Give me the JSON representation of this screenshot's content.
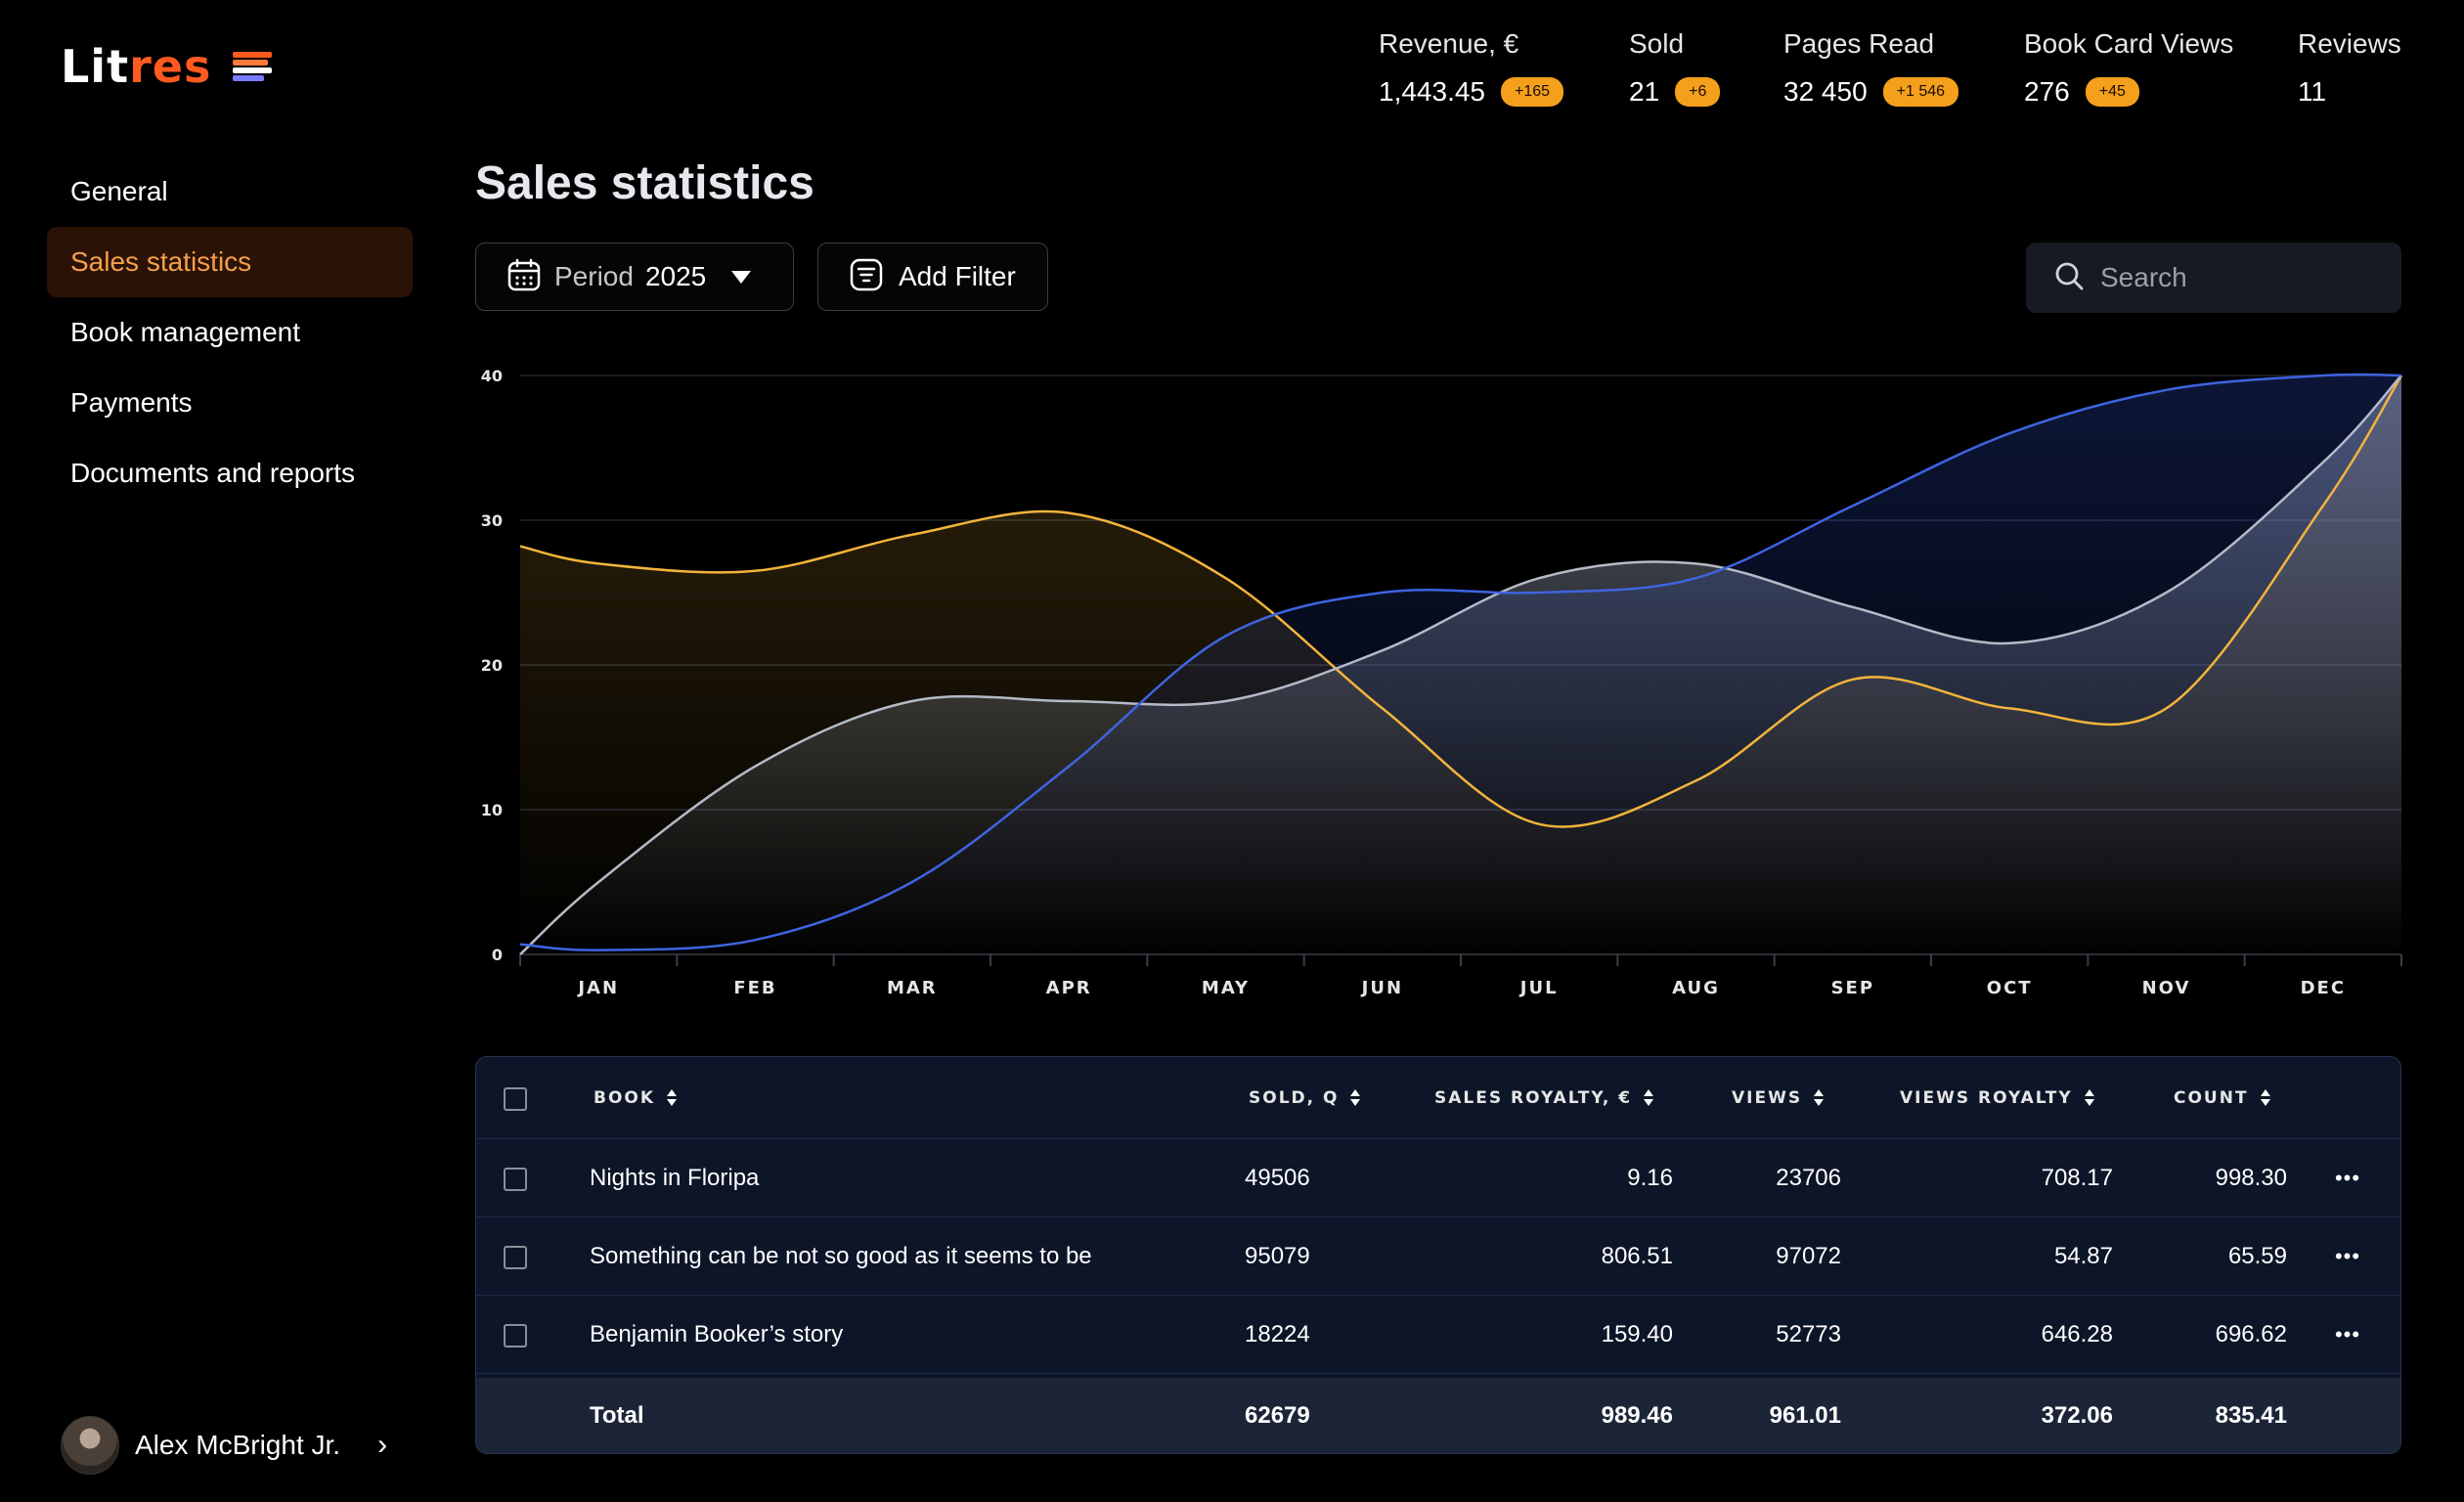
{
  "brand": {
    "logo_part1": "Lit",
    "logo_part2": "res",
    "accent": "#ff5a1f"
  },
  "stats": [
    {
      "label": "Revenue, €",
      "value": "1,443.45",
      "badge": "+165"
    },
    {
      "label": "Sold",
      "value": "21",
      "badge": "+6"
    },
    {
      "label": "Pages Read",
      "value": "32 450",
      "badge": "+1 546"
    },
    {
      "label": "Book Card Views",
      "value": "276",
      "badge": "+45"
    },
    {
      "label": "Reviews",
      "value": "11",
      "badge": ""
    }
  ],
  "sidebar": {
    "items": [
      {
        "label": "General",
        "active": false
      },
      {
        "label": "Sales statistics",
        "active": true
      },
      {
        "label": "Book management",
        "active": false
      },
      {
        "label": "Payments",
        "active": false
      },
      {
        "label": "Documents and reports",
        "active": false
      }
    ]
  },
  "user": {
    "name": "Alex McBright Jr."
  },
  "page": {
    "title": "Sales statistics"
  },
  "controls": {
    "period_label": "Period",
    "period_value": "2025",
    "add_filter_label": "Add Filter",
    "search_placeholder": "Search"
  },
  "chart_data": {
    "type": "area",
    "categories": [
      "JAN",
      "FEB",
      "MAR",
      "APR",
      "MAY",
      "JUN",
      "JUL",
      "AUG",
      "SEP",
      "OCT",
      "NOV",
      "DEC"
    ],
    "ylim": [
      0,
      40
    ],
    "yticks": [
      0,
      10,
      20,
      30,
      40
    ],
    "grid": true,
    "series": [
      {
        "color": "#f2b43c",
        "x": [
          0,
          0.5,
          1.5,
          2.5,
          3.5,
          4.5,
          5.5,
          6.5,
          7.5,
          8.5,
          9.5,
          10.5,
          11.5,
          12
        ],
        "values": [
          28.2,
          27,
          26.5,
          29,
          30.5,
          26,
          17,
          9,
          12,
          19,
          17,
          17,
          31,
          40
        ]
      },
      {
        "color": "#b4bac6",
        "x": [
          0,
          0.5,
          1.5,
          2.5,
          3.5,
          4.5,
          5.5,
          6.5,
          7.5,
          8.5,
          9.5,
          10.5,
          11.5,
          12
        ],
        "values": [
          0,
          5,
          13,
          17.5,
          17.5,
          17.5,
          21,
          26,
          27,
          24,
          21.5,
          25,
          34,
          40
        ]
      },
      {
        "color": "#3e64e0",
        "x": [
          0,
          0.5,
          1.5,
          2.5,
          3.5,
          4.5,
          5.5,
          6.5,
          7.5,
          8.5,
          9.5,
          10.5,
          11.5,
          12
        ],
        "values": [
          0.7,
          0.3,
          1,
          5,
          13,
          22,
          25,
          25,
          26,
          31,
          36,
          39,
          40,
          40
        ]
      }
    ]
  },
  "table": {
    "headers": [
      "BOOK",
      "SOLD, Q",
      "SALES ROYALTY, €",
      "VIEWS",
      "VIEWS ROYALTY",
      "COUNT"
    ],
    "rows": [
      [
        "Nights in Floripa",
        "49506",
        "9.16",
        "23706",
        "708.17",
        "998.30"
      ],
      [
        "Something can be not so good as it seems to be",
        "95079",
        "806.51",
        "97072",
        "54.87",
        "65.59"
      ],
      [
        "Benjamin Booker’s story",
        "18224",
        "159.40",
        "52773",
        "646.28",
        "696.62"
      ]
    ],
    "total": [
      "Total",
      "62679",
      "989.46",
      "961.01",
      "372.06",
      "835.41"
    ],
    "more_glyph": "•••"
  }
}
